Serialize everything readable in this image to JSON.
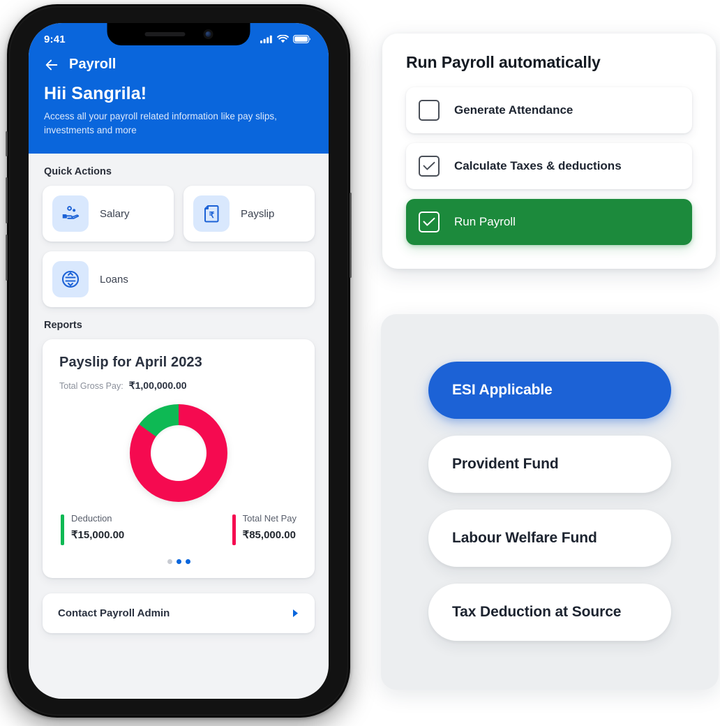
{
  "phone": {
    "status_bar": {
      "time": "9:41",
      "signal_icon": "cellular-signal-icon",
      "wifi_icon": "wifi-icon",
      "battery_icon": "battery-icon"
    },
    "header": {
      "back_icon": "back-arrow-icon",
      "nav_title": "Payroll",
      "greeting": "Hii Sangrila!",
      "subtitle": "Access all your payroll related information like pay slips, investments and more",
      "background_color": "#0a66dc"
    },
    "quick_actions": {
      "section_title": "Quick Actions",
      "items": [
        {
          "label": "Salary",
          "icon": "salary-hand-coins-icon"
        },
        {
          "label": "Payslip",
          "icon": "payslip-document-rupee-icon"
        },
        {
          "label": "Loans",
          "icon": "loans-transfer-circle-icon"
        }
      ]
    },
    "reports": {
      "section_title": "Reports",
      "card": {
        "title": "Payslip for April 2023",
        "gross_label": "Total Gross Pay:",
        "gross_value": "₹1,00,000.00",
        "legend": [
          {
            "name": "Deduction",
            "value": "₹15,000.00",
            "color": "#0eb954"
          },
          {
            "name": "Total Net Pay",
            "value": "₹85,000.00",
            "color": "#f50a50"
          }
        ],
        "pagination": {
          "count": 3,
          "active_indices": [
            1,
            2
          ]
        }
      }
    },
    "contact": {
      "label": "Contact Payroll Admin",
      "chevron_icon": "chevron-right-icon"
    }
  },
  "chart_data": {
    "type": "pie",
    "title": "Payslip for April 2023",
    "labels": [
      "Total Net Pay",
      "Deduction"
    ],
    "values": [
      85000,
      15000
    ],
    "display_values": [
      "₹85,000.00",
      "₹15,000.00"
    ],
    "colors": [
      "#f50a50",
      "#0eb954"
    ],
    "total": 100000,
    "total_display": "₹1,00,000.00",
    "legend_position": "bottom",
    "donut": true,
    "hole_ratio": 0.57,
    "note": "Red arc spans from 12 o'clock clockwise ~26% of circle; green arc covers remaining ~74%"
  },
  "auto_payroll_card": {
    "title": "Run Payroll automatically",
    "items": [
      {
        "label": "Generate Attendance",
        "checked": false,
        "selected": false
      },
      {
        "label": "Calculate Taxes & deductions",
        "checked": true,
        "selected": false
      },
      {
        "label": "Run Payroll",
        "checked": true,
        "selected": true
      }
    ],
    "selected_color": "#1c8a3c"
  },
  "deductions_card": {
    "items": [
      {
        "label": "ESI Applicable",
        "selected": true
      },
      {
        "label": "Provident Fund",
        "selected": false
      },
      {
        "label": "Labour Welfare Fund",
        "selected": false
      },
      {
        "label": "Tax Deduction at Source",
        "selected": false
      }
    ],
    "selected_color": "#1c62d6"
  }
}
